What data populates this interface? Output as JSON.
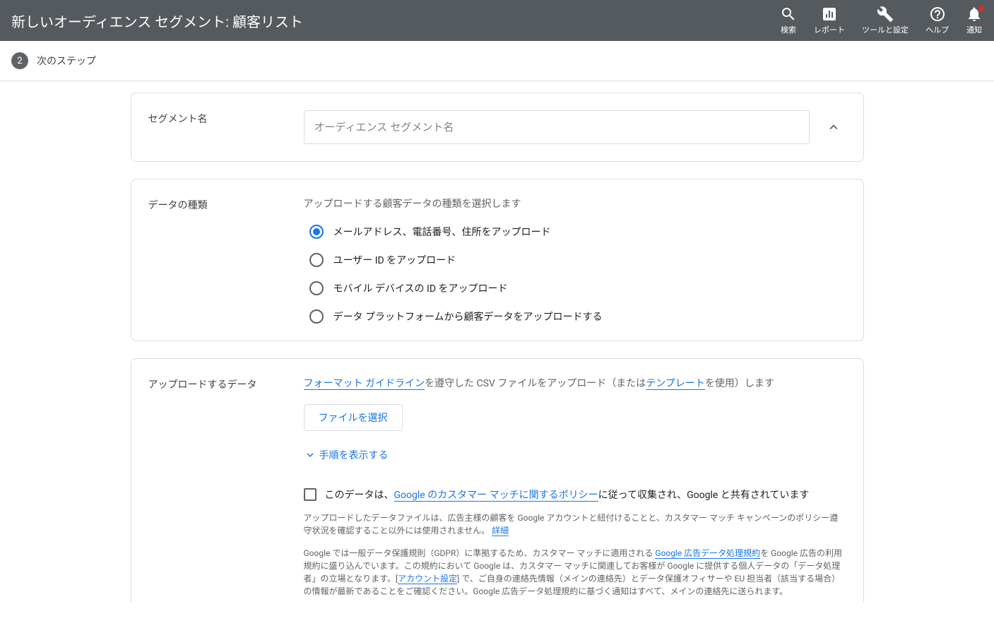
{
  "header": {
    "title": "新しいオーディエンス セグメント: 顧客リスト",
    "icons": [
      {
        "name": "search-icon",
        "label": "検索"
      },
      {
        "name": "report-icon",
        "label": "レポート"
      },
      {
        "name": "tools-icon",
        "label": "ツールと設定"
      },
      {
        "name": "help-icon",
        "label": "ヘルプ"
      },
      {
        "name": "bell-icon",
        "label": "通知",
        "badge": true
      }
    ]
  },
  "step": {
    "number": "2",
    "label": "次のステップ"
  },
  "card1": {
    "label": "セグメント名",
    "placeholder": "オーディエンス セグメント名"
  },
  "card2": {
    "label": "データの種類",
    "subtitle": "アップロードする顧客データの種類を選択します",
    "options": [
      "メールアドレス、電話番号、住所をアップロード",
      "ユーザー ID をアップロード",
      "モバイル デバイスの ID をアップロード",
      "データ プラットフォームから顧客データをアップロードする"
    ],
    "selected": 0
  },
  "card3": {
    "label": "アップロードするデータ",
    "desc": {
      "link1": "フォーマット ガイドライン",
      "mid1": "を遵守した CSV ファイルをアップロード（または",
      "link2": "テンプレート",
      "mid2": "を使用）します"
    },
    "choose_file": "ファイルを選択",
    "expand": "手順を表示する",
    "checkbox": {
      "prefix": "このデータは、",
      "link": "Google のカスタマー マッチに関するポリシー",
      "suffix": "に従って収集され、Google と共有されています"
    },
    "fine1_a": "アップロードしたデータファイルは、広告主様の顧客を Google アカウントと紐付けることと、カスタマー マッチ キャンペーンのポリシー遵守状況を確認すること以外には使用されません。 ",
    "fine1_link": "詳細",
    "fine2_a": "Google では一般データ保護規則（GDPR）に準拠するため、カスタマー マッチに適用される ",
    "fine2_link1": "Google 広告データ処理規約",
    "fine2_b": "を Google 広告の利用規約に盛り込んでいます。この規約において Google は、カスタマー マッチに関連してお客様が Google に提供する個人データの「データ処理者」の立場となります。[",
    "fine2_link2": "アカウント設定",
    "fine2_c": "] で、ご自身の連絡先情報（メインの連絡先）とデータ保護オフィサーや EU 担当者（該当する場合）の情報が最新であることをご確認ください。Google 広告データ処理規約に基づく通知はすべて、メインの連絡先に送られます。"
  }
}
